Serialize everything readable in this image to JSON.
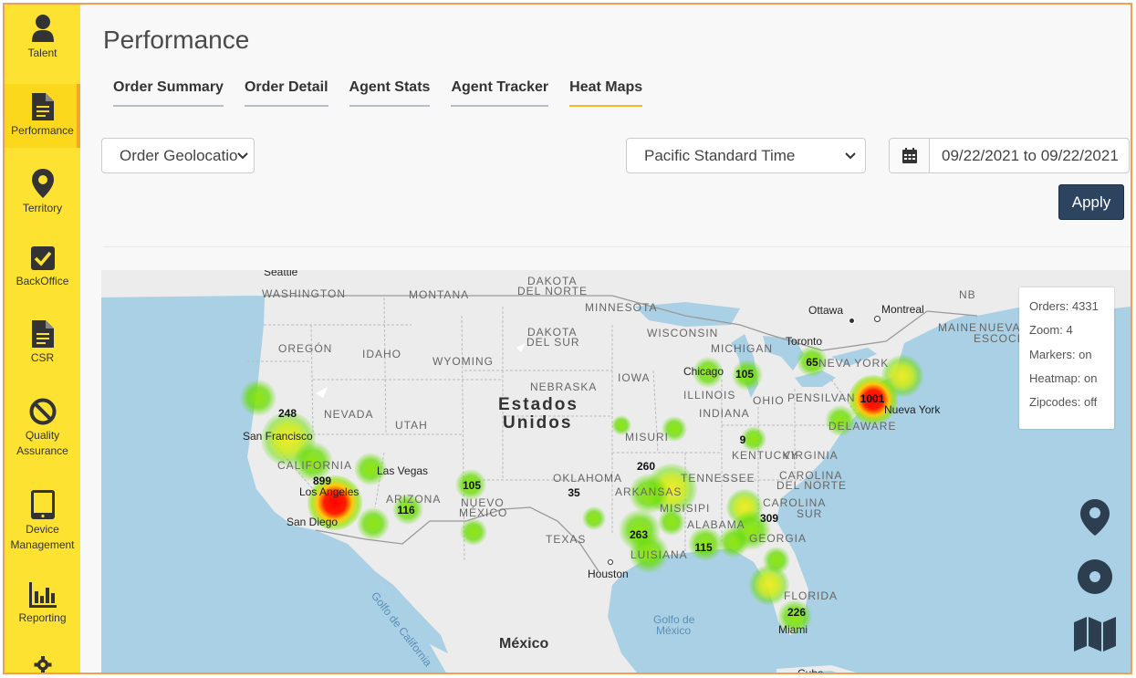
{
  "sidebar": {
    "items": [
      {
        "label": "Talent",
        "icon": "person-icon"
      },
      {
        "label": "Performance",
        "icon": "document-icon",
        "active": true
      },
      {
        "label": "Territory",
        "icon": "map-pin-icon"
      },
      {
        "label": "BackOffice",
        "icon": "checkbox-icon"
      },
      {
        "label": "CSR",
        "icon": "document-icon"
      },
      {
        "label": "Quality Assurance",
        "icon": "ban-icon"
      },
      {
        "label": "Device Management",
        "icon": "tablet-icon"
      },
      {
        "label": "Reporting",
        "icon": "bar-chart-icon"
      },
      {
        "label": "",
        "icon": "gear-icon"
      }
    ]
  },
  "page": {
    "title": "Performance"
  },
  "tabs": [
    {
      "label": "Order Summary"
    },
    {
      "label": "Order Detail"
    },
    {
      "label": "Agent Stats"
    },
    {
      "label": "Agent Tracker"
    },
    {
      "label": "Heat Maps",
      "active": true
    }
  ],
  "filters": {
    "report_type": "Order Geolocation",
    "timezone": "Pacific Standard Time",
    "date_range": "09/22/2021 to 09/22/2021",
    "apply_label": "Apply"
  },
  "map": {
    "labels": {
      "estados": "Estados",
      "unidos": "Unidos",
      "mexico": "México",
      "golfo_mexico_1": "Golfo de",
      "golfo_mexico_2": "México",
      "golfo_california": "Golfo de California",
      "seattle": "Seattle",
      "washington": "WASHINGTON",
      "montana": "MONTANA",
      "dakota_norte_1": "DAKOTA",
      "dakota_norte_2": "DEL NORTE",
      "dakota_sur_1": "DAKOTA",
      "dakota_sur_2": "DEL SUR",
      "minnesota": "MINNESOTA",
      "wisconsin": "WISCONSIN",
      "michigan": "MICHIGAN",
      "ottawa": "Ottawa",
      "montreal": "Montreal",
      "maine": "MAINE",
      "nueva_escocia_1": "NUEVA",
      "nueva_escocia_2": "ESCOCI",
      "nb": "NB",
      "oregon": "OREGÓN",
      "idaho": "IDAHO",
      "wyoming": "WYOMING",
      "nebraska": "NEBRASKA",
      "iowa": "IOWA",
      "chicago": "Chicago",
      "toronto": "Toronto",
      "new_york_state": "NEVA YORK",
      "illinois": "ILLINOIS",
      "ohio": "OHIO",
      "pensilvania": "PENSILVAN",
      "nueva_york_city": "Nueva York",
      "delaware": "DELAWARE",
      "nevada": "NEVADA",
      "utah": "UTAH",
      "san_francisco": "San Francisco",
      "indiana": "INDIANA",
      "misuri": "MISURI",
      "kentucky": "KENTUCKY",
      "virginia": "VIRGINIA",
      "california": "CALIFORNIA",
      "las_vegas": "Las Vegas",
      "oklahoma": "OKLAHOMA",
      "tennessee": "TENNESSEE",
      "carolina_norte_1": "CAROLINA",
      "carolina_norte_2": "DEL NORTE",
      "carolina_sur": "CAROLINA",
      "carolina_sur_2": "SUR",
      "los_angeles": "Los Angeles",
      "arizona": "ARIZONA",
      "nuevo_mexico_1": "NUEVO",
      "nuevo_mexico_2": "MÉXICO",
      "arkansas": "ARKANSAS",
      "misisipi": "MISISIPI",
      "alabama": "ALABAMA",
      "georgia": "GEORGIA",
      "san_diego": "San Diego",
      "texas": "TEXAS",
      "houston": "Houston",
      "luisiana": "LUISIANA",
      "florida": "FLORIDA",
      "miami": "Miami",
      "cuba": "Cuba"
    },
    "counts": [
      {
        "value": "248"
      },
      {
        "value": "899"
      },
      {
        "value": "116"
      },
      {
        "value": "105"
      },
      {
        "value": "35"
      },
      {
        "value": "260"
      },
      {
        "value": "263"
      },
      {
        "value": "115"
      },
      {
        "value": "309"
      },
      {
        "value": "9"
      },
      {
        "value": "105"
      },
      {
        "value": "65"
      },
      {
        "value": "1001"
      },
      {
        "value": "226"
      }
    ],
    "stats": {
      "orders": "Orders: 4331",
      "zoom": "Zoom: 4",
      "markers": "Markers: on",
      "heatmap": "Heatmap: on",
      "zipcodes": "Zipcodes: off"
    },
    "controls": [
      "marker-toggle-icon",
      "heatmap-toggle-icon",
      "zipcode-map-icon"
    ]
  },
  "colors": {
    "sidebar": "#fde232",
    "accent": "#f5b82a",
    "apply": "#2c4460",
    "water": "#a9d0e4",
    "land": "#eeeeee"
  }
}
